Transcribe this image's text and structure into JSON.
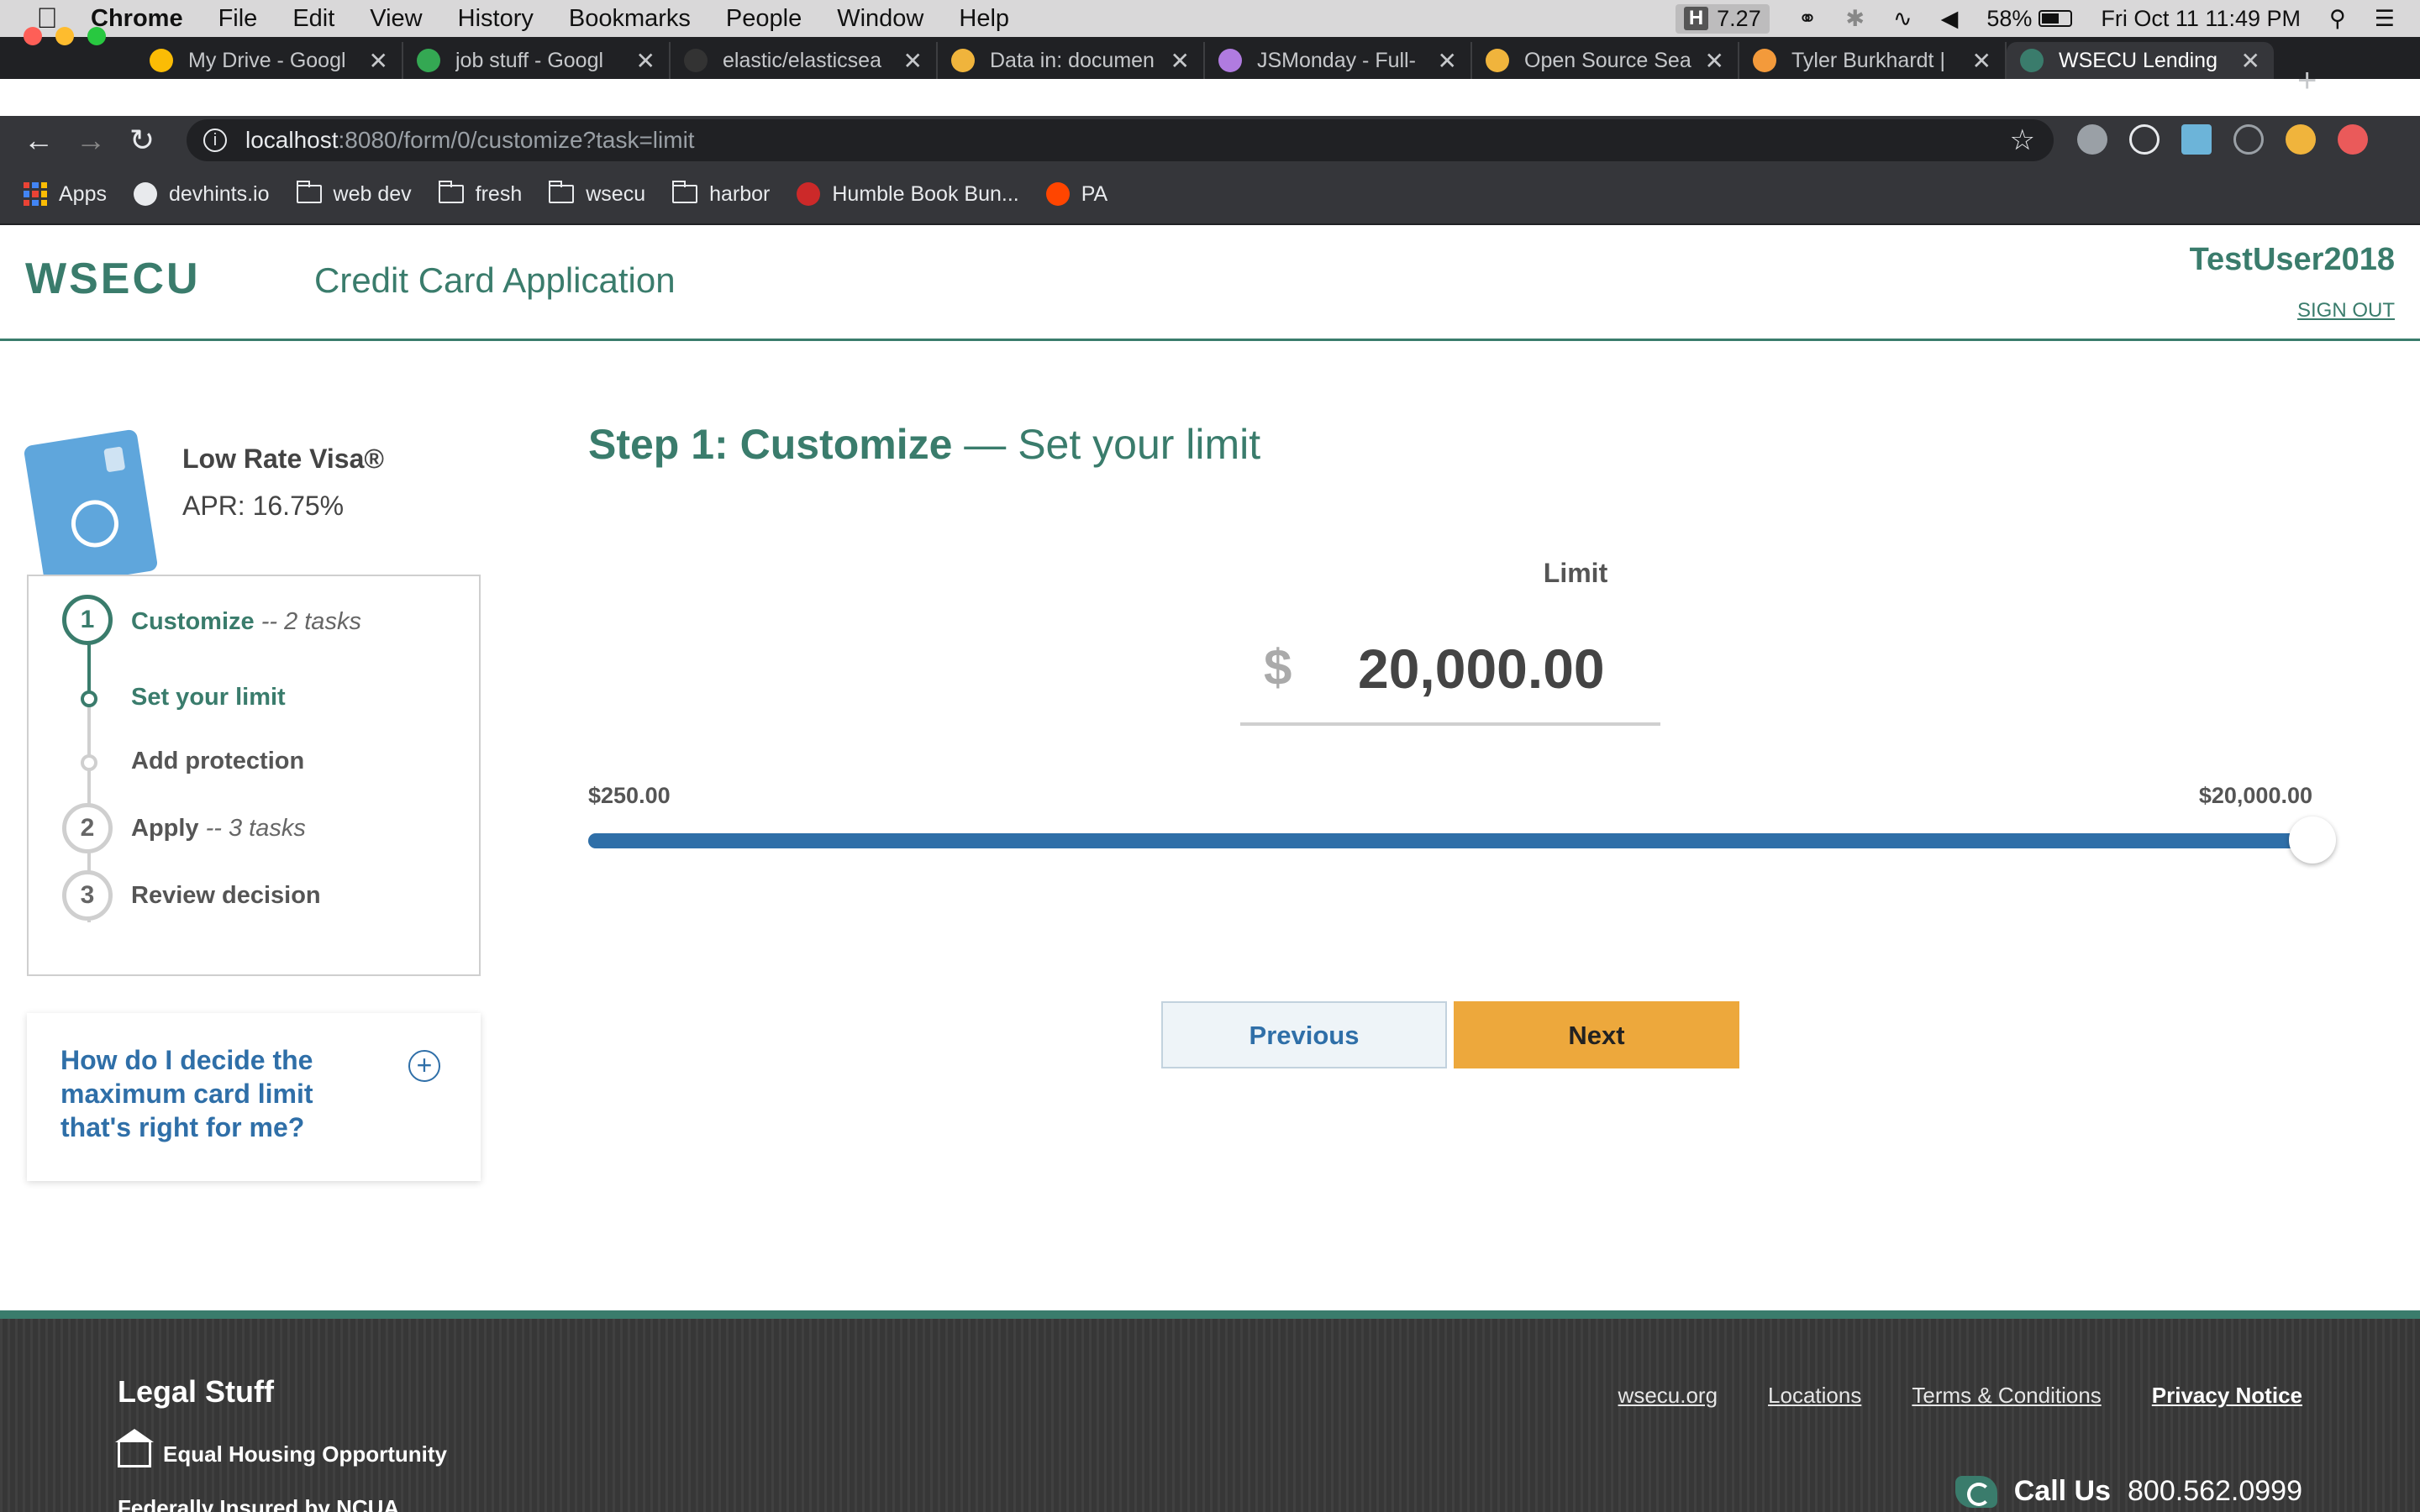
{
  "menubar": {
    "apple": "",
    "items": [
      "Chrome",
      "File",
      "Edit",
      "View",
      "History",
      "Bookmarks",
      "People",
      "Window",
      "Help"
    ],
    "tray_h": "H",
    "tray_value": "7.27",
    "battery": "58%",
    "datetime": "Fri Oct 11  11:49 PM"
  },
  "tabs": [
    {
      "title": "My Drive - Googl",
      "favicon_color": "#fbbc05"
    },
    {
      "title": "job stuff - Googl",
      "favicon_color": "#34a853"
    },
    {
      "title": "elastic/elasticsea",
      "favicon_color": "#333333"
    },
    {
      "title": "Data in: documen",
      "favicon_color": "#f0b43c"
    },
    {
      "title": "JSMonday - Full-",
      "favicon_color": "#b07be0"
    },
    {
      "title": "Open Source Sea",
      "favicon_color": "#f0b43c"
    },
    {
      "title": "Tyler Burkhardt |",
      "favicon_color": "#f39a3b"
    },
    {
      "title": "WSECU Lending",
      "favicon_color": "#3a7c6c"
    }
  ],
  "toolbar": {
    "host": "localhost",
    "path": ":8080/form/0/customize?task=limit"
  },
  "bookmarks": [
    {
      "label": "Apps",
      "icon": "apps-grid-icon"
    },
    {
      "label": "devhints.io",
      "icon": "globe-icon"
    },
    {
      "label": "web dev",
      "icon": "folder-icon"
    },
    {
      "label": "fresh",
      "icon": "folder-icon"
    },
    {
      "label": "wsecu",
      "icon": "folder-icon"
    },
    {
      "label": "harbor",
      "icon": "folder-icon"
    },
    {
      "label": "Humble Book Bun...",
      "icon": "humble-icon"
    },
    {
      "label": "PA",
      "icon": "reddit-icon"
    }
  ],
  "header": {
    "logo": "WSECU",
    "title": "Credit Card Application",
    "username": "TestUser2018",
    "signout": "SIGN OUT"
  },
  "product": {
    "name": "Low Rate Visa®",
    "apr": "APR: 16.75%"
  },
  "steps": {
    "s1_num": "1",
    "s1_label": "Customize",
    "s1_sub": " -- 2 tasks",
    "task1": "Set your limit",
    "task2": "Add protection",
    "s2_num": "2",
    "s2_label": "Apply",
    "s2_sub": " -- 3 tasks",
    "s3_num": "3",
    "s3_label": "Review decision"
  },
  "faq": {
    "question": "How do I decide the maximum card limit that's right for me?",
    "toggle": "+"
  },
  "main": {
    "heading_bold": "Step 1: Customize",
    "heading_rest": " — Set your limit",
    "limit_label": "Limit",
    "currency": "$",
    "limit_value": "20,000.00",
    "range_min": "$250.00",
    "range_max": "$20,000.00",
    "slider_fraction": 1.0,
    "previous": "Previous",
    "next": "Next"
  },
  "footer": {
    "legal_title": "Legal Stuff",
    "eho": "Equal Housing Opportunity",
    "ncua": "Federally Insured by NCUA",
    "links": [
      "wsecu.org",
      "Locations",
      "Terms & Conditions",
      "Privacy Notice"
    ],
    "call_label": "Call Us",
    "phone": "800.562.0999"
  },
  "colors": {
    "brand_green": "#3a7c6c",
    "link_blue": "#2f6fa8",
    "next_orange": "#eda83c"
  }
}
